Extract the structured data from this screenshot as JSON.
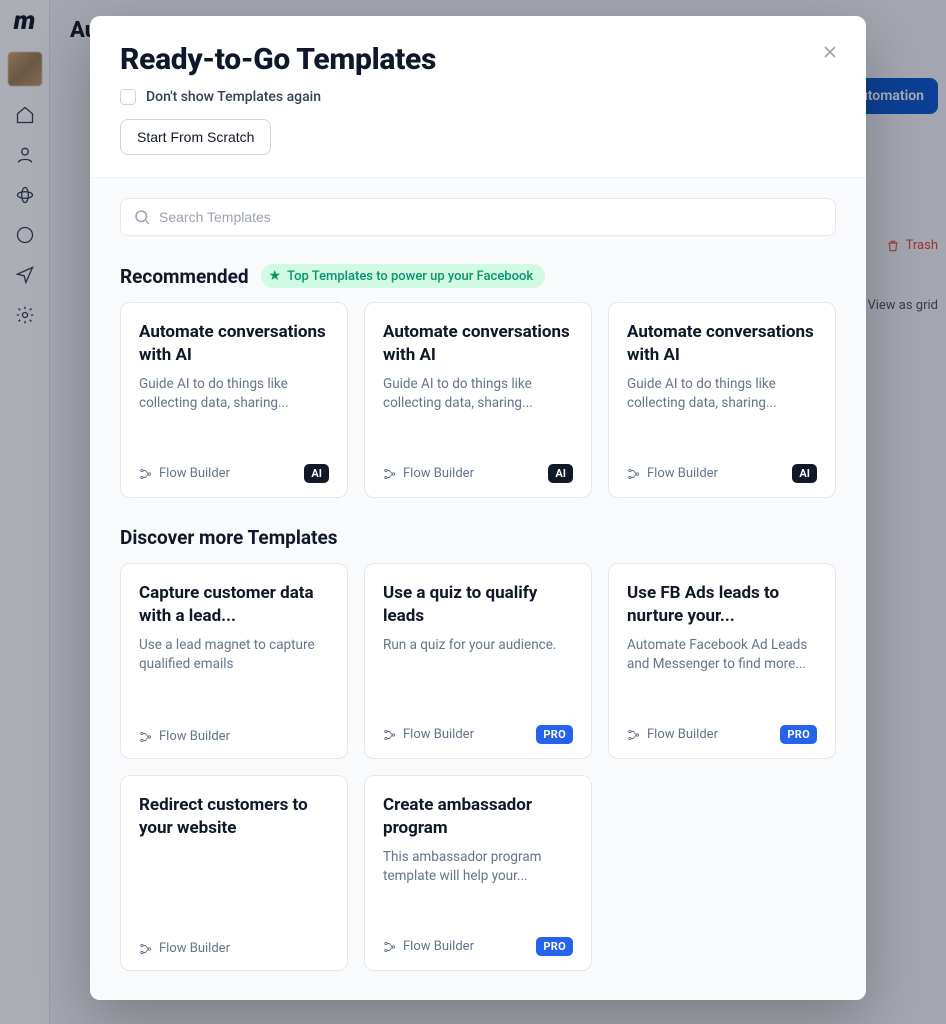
{
  "background": {
    "page_title": "Automation",
    "primary_button": "+ New Automation",
    "trash_label": "Trash",
    "view_as_grid_label": "View as grid"
  },
  "modal": {
    "title": "Ready-to-Go Templates",
    "dont_show_label": "Don't show Templates again",
    "start_from_scratch": "Start From Scratch",
    "search_placeholder": "Search Templates",
    "recommended_heading": "Recommended",
    "top_badge": "Top Templates to power up your Facebook",
    "discover_heading": "Discover more Templates",
    "flow_builder_label": "Flow Builder",
    "tag_ai": "AI",
    "tag_pro": "PRO",
    "recommended": [
      {
        "title": "Automate conversations with AI",
        "desc": "Guide AI to do things like collecting data, sharing...",
        "tag": "AI"
      },
      {
        "title": "Automate conversations with AI",
        "desc": "Guide AI to do things like collecting data, sharing...",
        "tag": "AI"
      },
      {
        "title": "Automate conversations with AI",
        "desc": "Guide AI to do things like collecting data, sharing...",
        "tag": "AI"
      }
    ],
    "discover": [
      {
        "title": "Capture customer data with a lead...",
        "desc": "Use a lead magnet to capture qualified emails",
        "tag": ""
      },
      {
        "title": "Use a quiz to qualify leads",
        "desc": "Run a quiz for your audience.",
        "tag": "PRO"
      },
      {
        "title": "Use FB Ads leads to nurture your...",
        "desc": "Automate Facebook Ad Leads and Messenger to find more...",
        "tag": "PRO"
      },
      {
        "title": "Redirect customers to your website",
        "desc": "",
        "tag": ""
      },
      {
        "title": "Create ambassador program",
        "desc": "This ambassador program template will help your...",
        "tag": "PRO"
      }
    ]
  }
}
